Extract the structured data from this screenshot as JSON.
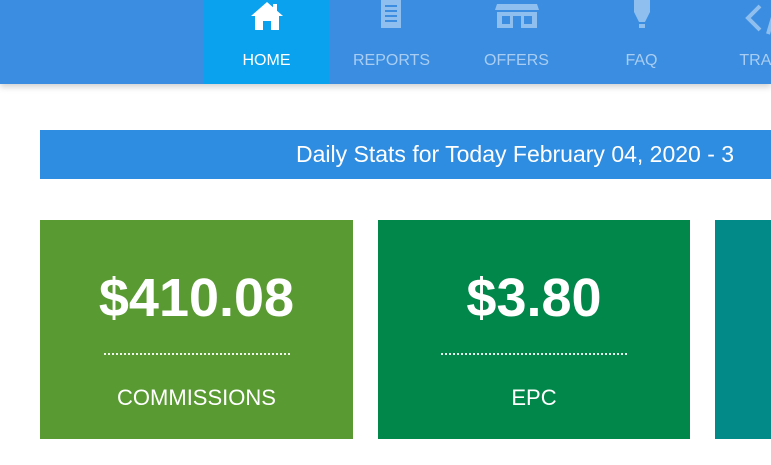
{
  "nav": {
    "items": [
      {
        "label": "HOME",
        "icon": "home-icon"
      },
      {
        "label": "REPORTS",
        "icon": "document-icon"
      },
      {
        "label": "OFFERS",
        "icon": "store-icon"
      },
      {
        "label": "FAQ",
        "icon": "lightbulb-icon"
      },
      {
        "label": "TRACK",
        "icon": "code-icon"
      }
    ]
  },
  "banner": {
    "text": "Daily Stats for Today February 04, 2020 - 3"
  },
  "cards": [
    {
      "value": "$410.08",
      "label": "COMMISSIONS",
      "color": "#5a9a32"
    },
    {
      "value": "$3.80",
      "label": "EPC",
      "color": "#02874a"
    },
    {
      "value": "",
      "label": "",
      "color": "#028a88"
    }
  ],
  "colors": {
    "topbar": "#3a8de0",
    "active": "#0aa2ee",
    "banner": "#2f8de1"
  }
}
